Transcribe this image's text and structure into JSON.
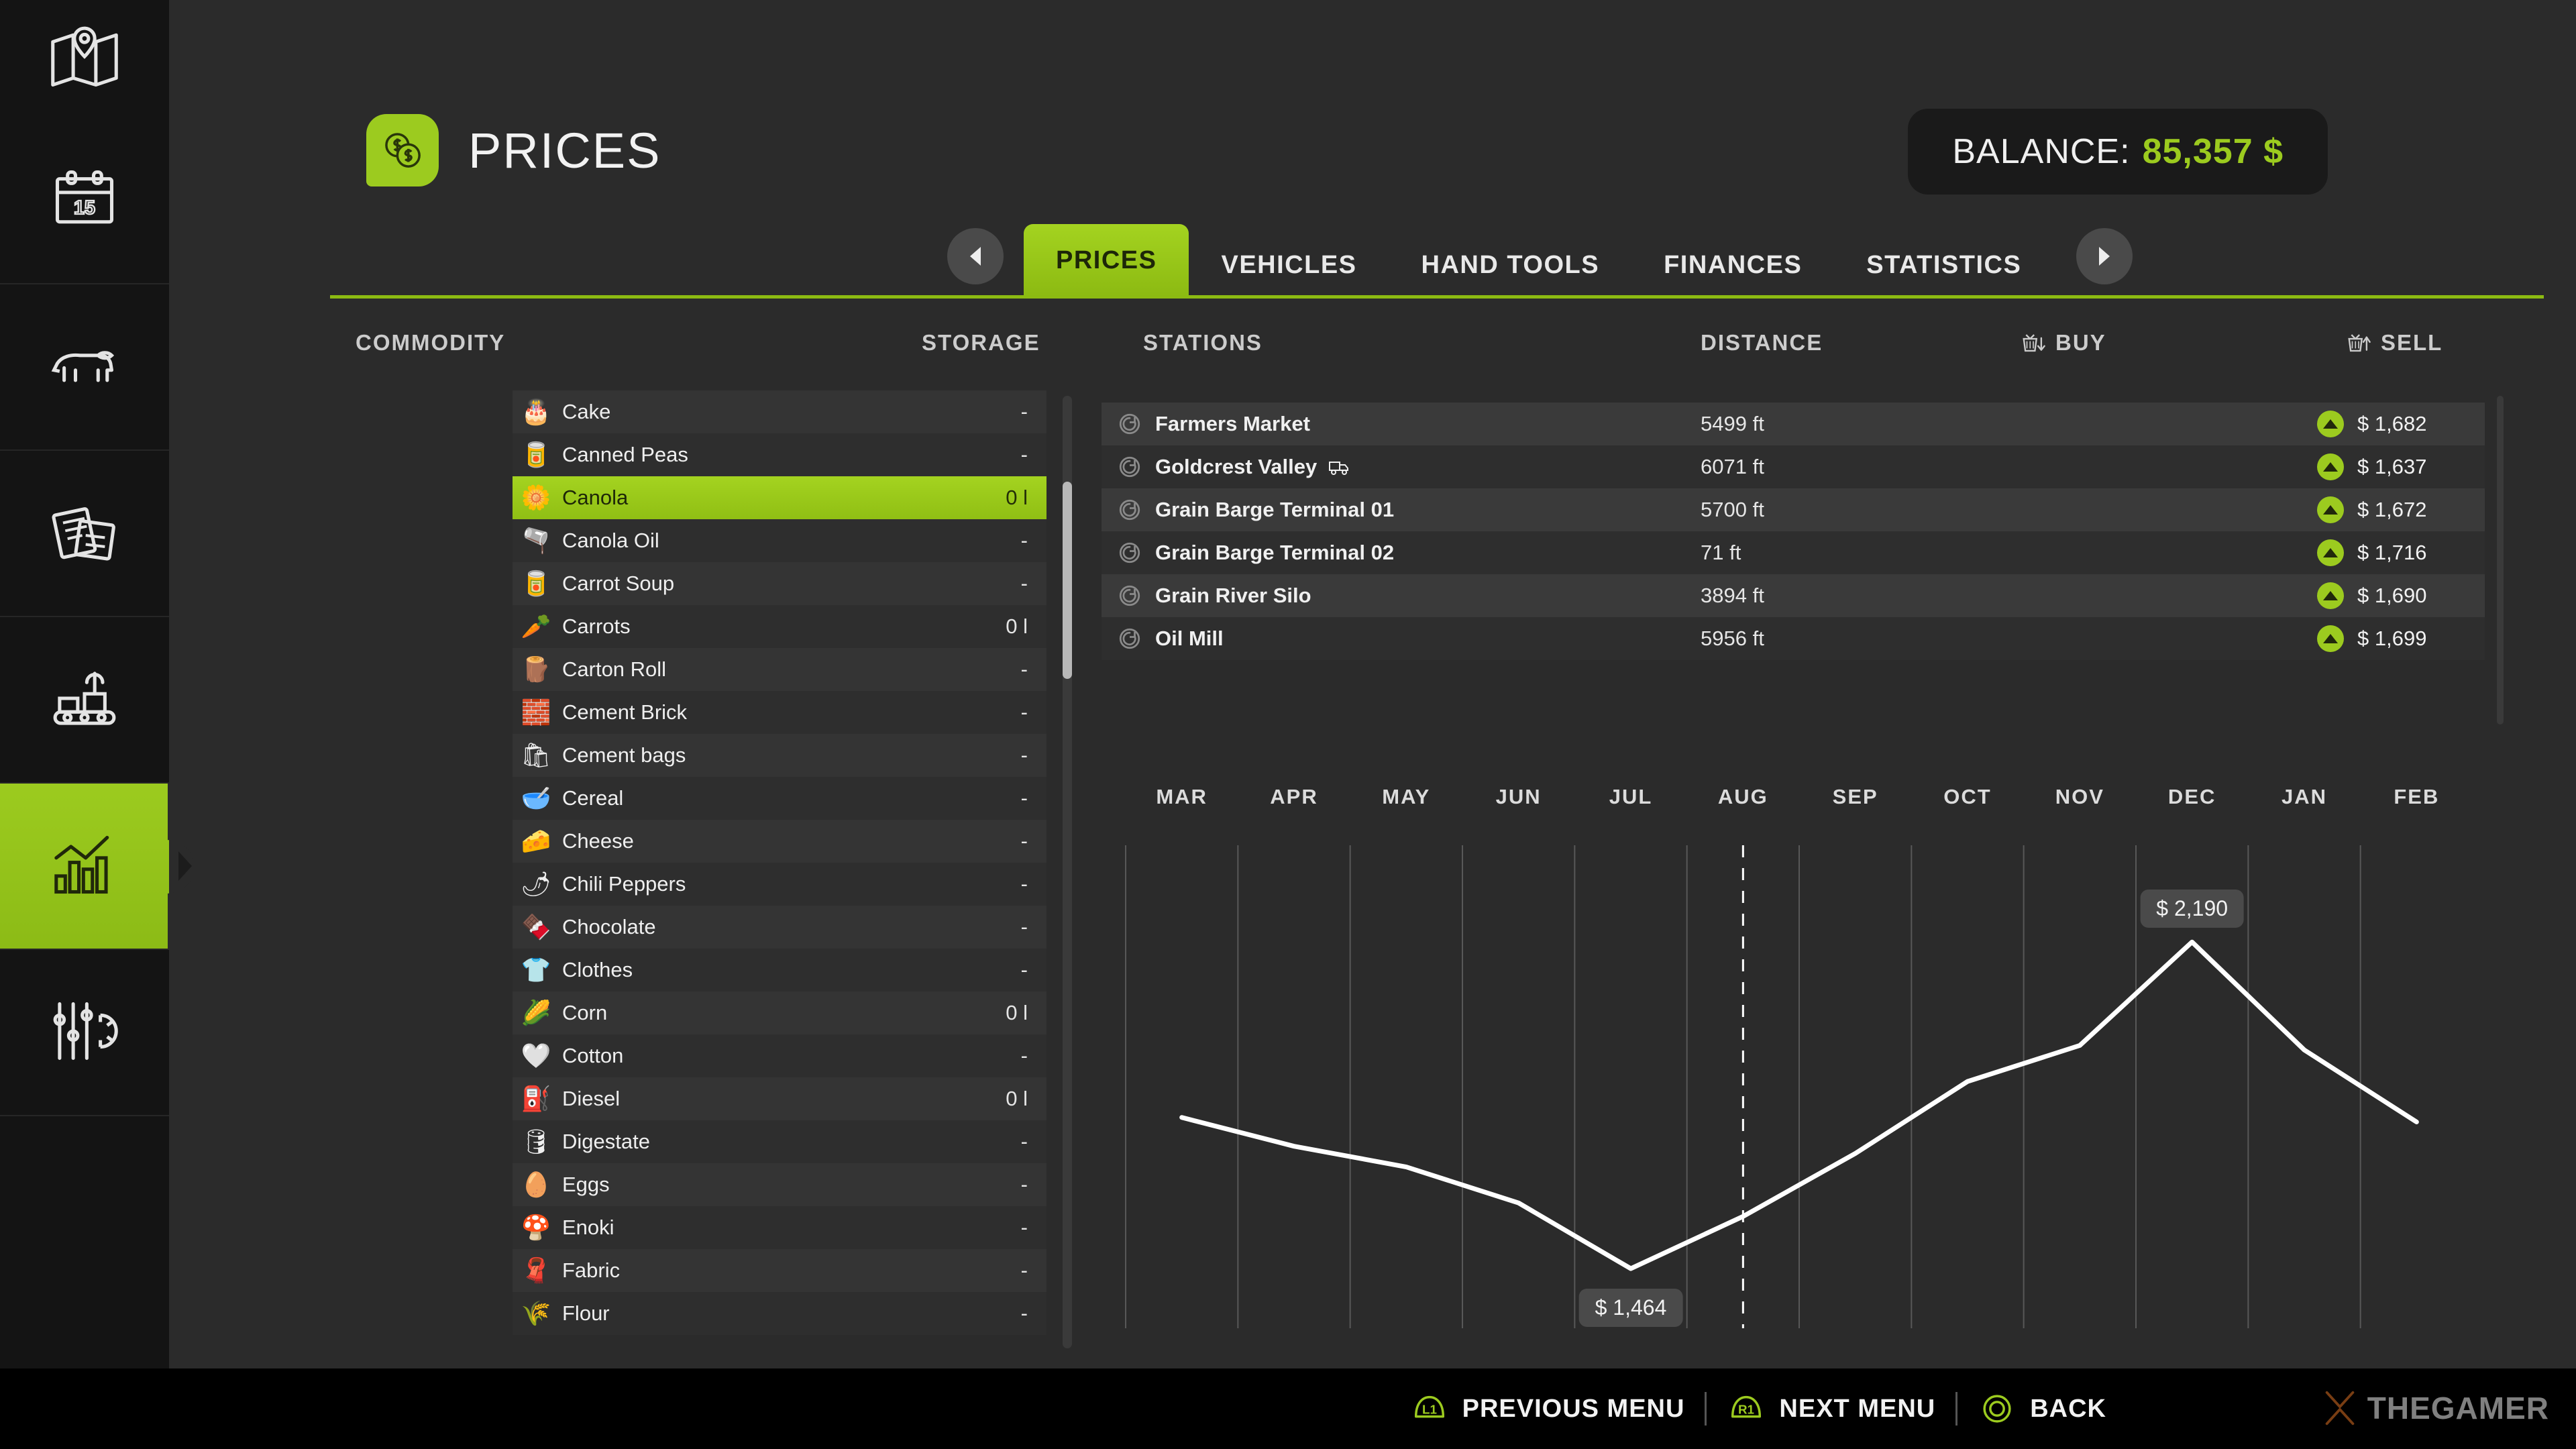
{
  "sidebar": {
    "items": [
      {
        "name": "map",
        "icon": "map-icon",
        "active": false
      },
      {
        "name": "calendar",
        "icon": "calendar-icon",
        "badge": "15",
        "active": false
      },
      {
        "name": "animals",
        "icon": "cow-icon",
        "active": false
      },
      {
        "name": "contracts",
        "icon": "documents-icon",
        "active": false
      },
      {
        "name": "production",
        "icon": "conveyor-icon",
        "active": false
      },
      {
        "name": "statistics",
        "icon": "bar-chart-icon",
        "active": true
      },
      {
        "name": "settings",
        "icon": "sliders-gear-icon",
        "active": false
      }
    ]
  },
  "header": {
    "title": "PRICES",
    "icon": "coins-dollar-icon",
    "balance_label": "BALANCE:",
    "balance_value": "85,357 $"
  },
  "tabs": {
    "prev_arrow": "chevron-left-icon",
    "next_arrow": "chevron-right-icon",
    "items": [
      {
        "label": "PRICES",
        "active": true
      },
      {
        "label": "VEHICLES",
        "active": false
      },
      {
        "label": "HAND TOOLS",
        "active": false
      },
      {
        "label": "FINANCES",
        "active": false
      },
      {
        "label": "STATISTICS",
        "active": false
      }
    ]
  },
  "columns": {
    "commodity": "COMMODITY",
    "storage": "STORAGE",
    "stations": "STATIONS",
    "distance": "DISTANCE",
    "buy": "BUY",
    "sell": "SELL",
    "buy_icon": "basket-down-icon",
    "sell_icon": "basket-up-icon"
  },
  "commodities": [
    {
      "name": "Cake",
      "icon": "🎂",
      "storage": "-",
      "selected": false
    },
    {
      "name": "Canned Peas",
      "icon": "🥫",
      "storage": "-",
      "selected": false
    },
    {
      "name": "Canola",
      "icon": "🌼",
      "storage": "0 l",
      "selected": true
    },
    {
      "name": "Canola Oil",
      "icon": "🫗",
      "storage": "-",
      "selected": false
    },
    {
      "name": "Carrot Soup",
      "icon": "🥫",
      "storage": "-",
      "selected": false
    },
    {
      "name": "Carrots",
      "icon": "🥕",
      "storage": "0 l",
      "selected": false
    },
    {
      "name": "Carton Roll",
      "icon": "🪵",
      "storage": "-",
      "selected": false
    },
    {
      "name": "Cement Brick",
      "icon": "🧱",
      "storage": "-",
      "selected": false
    },
    {
      "name": "Cement bags",
      "icon": "🛍",
      "storage": "-",
      "selected": false
    },
    {
      "name": "Cereal",
      "icon": "🥣",
      "storage": "-",
      "selected": false
    },
    {
      "name": "Cheese",
      "icon": "🧀",
      "storage": "-",
      "selected": false
    },
    {
      "name": "Chili Peppers",
      "icon": "🌶",
      "storage": "-",
      "selected": false
    },
    {
      "name": "Chocolate",
      "icon": "🍫",
      "storage": "-",
      "selected": false
    },
    {
      "name": "Clothes",
      "icon": "👕",
      "storage": "-",
      "selected": false
    },
    {
      "name": "Corn",
      "icon": "🌽",
      "storage": "0 l",
      "selected": false
    },
    {
      "name": "Cotton",
      "icon": "🤍",
      "storage": "-",
      "selected": false
    },
    {
      "name": "Diesel",
      "icon": "⛽",
      "storage": "0 l",
      "selected": false
    },
    {
      "name": "Digestate",
      "icon": "🛢",
      "storage": "-",
      "selected": false
    },
    {
      "name": "Eggs",
      "icon": "🥚",
      "storage": "-",
      "selected": false
    },
    {
      "name": "Enoki",
      "icon": "🍄",
      "storage": "-",
      "selected": false
    },
    {
      "name": "Fabric",
      "icon": "🧣",
      "storage": "-",
      "selected": false
    },
    {
      "name": "Flour",
      "icon": "🌾",
      "storage": "-",
      "selected": false
    }
  ],
  "stations": [
    {
      "name": "Farmers Market",
      "distance": "5499 ft",
      "price": "$ 1,682",
      "trend": "up",
      "has_truck": false
    },
    {
      "name": "Goldcrest Valley",
      "distance": "6071 ft",
      "price": "$ 1,637",
      "trend": "up",
      "has_truck": true
    },
    {
      "name": "Grain Barge Terminal 01",
      "distance": "5700 ft",
      "price": "$ 1,672",
      "trend": "up",
      "has_truck": false
    },
    {
      "name": "Grain Barge Terminal 02",
      "distance": "71 ft",
      "price": "$ 1,716",
      "trend": "up",
      "has_truck": false
    },
    {
      "name": "Grain River Silo",
      "distance": "3894 ft",
      "price": "$ 1,690",
      "trend": "up",
      "has_truck": false
    },
    {
      "name": "Oil Mill",
      "distance": "5956 ft",
      "price": "$ 1,699",
      "trend": "up",
      "has_truck": false
    }
  ],
  "chart_data": {
    "type": "line",
    "title": "",
    "xlabel": "",
    "ylabel": "",
    "grid": true,
    "legend": null,
    "categories": [
      "MAR",
      "APR",
      "MAY",
      "JUN",
      "JUL",
      "AUG",
      "SEP",
      "OCT",
      "NOV",
      "DEC",
      "JAN",
      "FEB"
    ],
    "values": [
      1800,
      1736,
      1690,
      1610,
      1464,
      1580,
      1720,
      1880,
      1960,
      2190,
      1950,
      1790
    ],
    "ylim": [
      1400,
      2250
    ],
    "min_point": {
      "category": "JUL",
      "label": "$ 1,464",
      "value": 1464
    },
    "max_point": {
      "category": "DEC",
      "label": "$ 2,190",
      "value": 2190
    },
    "current_marker": {
      "category": "AUG",
      "style": "dashed-vertical"
    },
    "line_color": "#ffffff"
  },
  "bottom_bar": {
    "actions": [
      {
        "key": "L1",
        "label": "PREVIOUS MENU",
        "glyph": "shoulder-button-icon"
      },
      {
        "key": "R1",
        "label": "NEXT MENU",
        "glyph": "shoulder-button-icon"
      },
      {
        "key": "",
        "label": "BACK",
        "glyph": "circle-button-icon"
      }
    ],
    "watermark": "THEGAMER"
  },
  "colors": {
    "accent_green": "#9ccb1f",
    "panel_bg": "#2b2b2b",
    "rail_bg": "#141414",
    "row_odd": "#343434",
    "row_even": "#2e2e2e",
    "line": "#ffffff"
  }
}
